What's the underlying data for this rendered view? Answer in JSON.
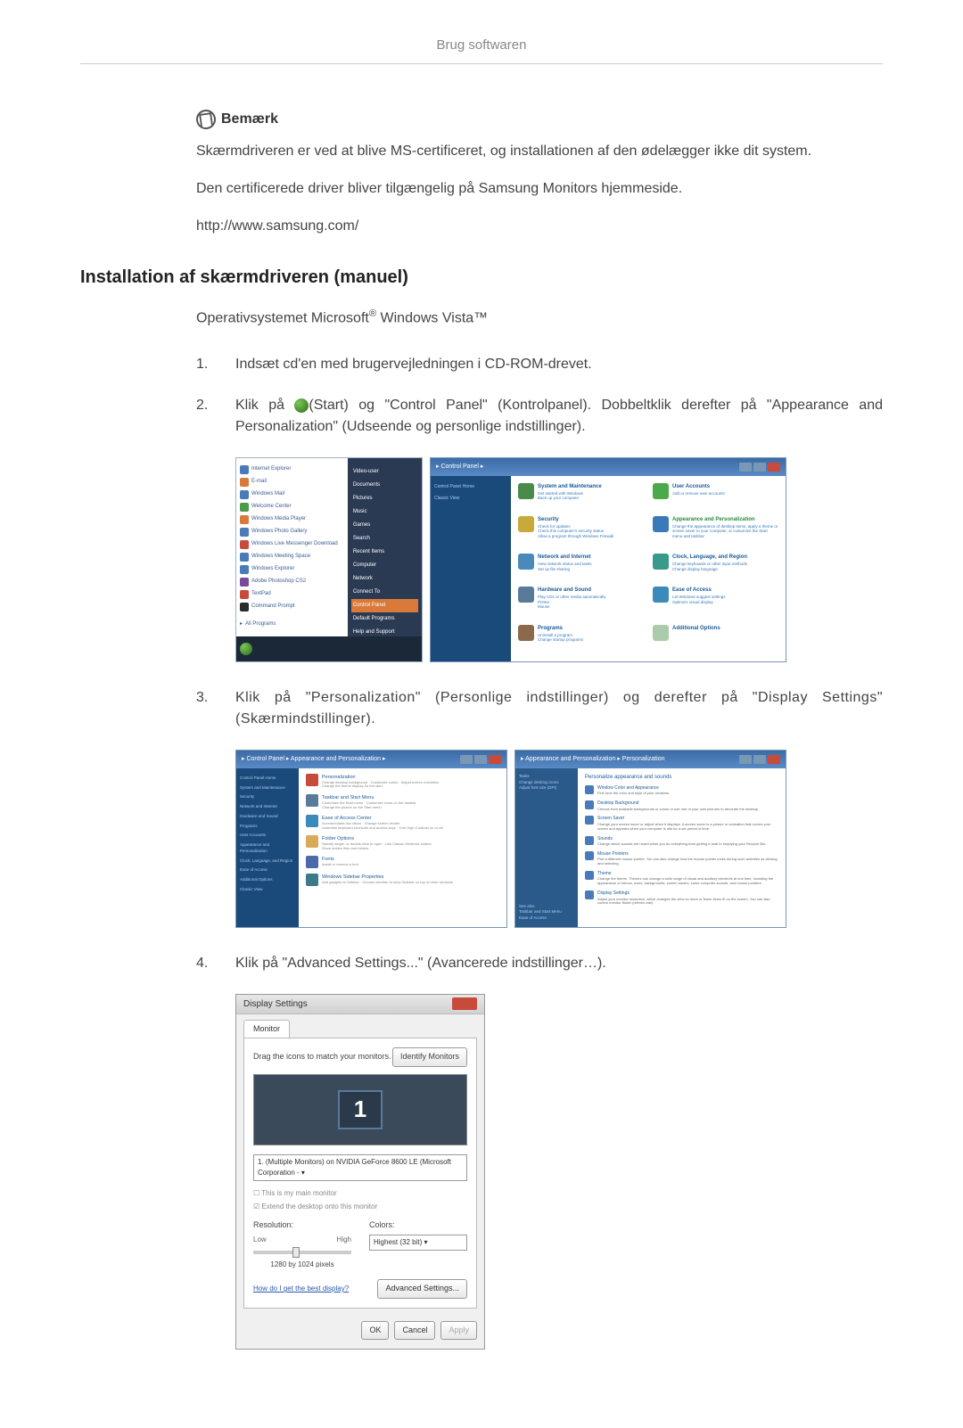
{
  "header": "Brug softwaren",
  "note": {
    "heading": "Bemærk",
    "para1": "Skærmdriveren er ved at blive MS-certificeret, og installationen af den ødelægger ikke dit system.",
    "para2": "Den certificerede driver bliver tilgængelig på Samsung Monitors hjemmeside.",
    "link": "http://www.samsung.com/"
  },
  "section": {
    "heading": "Installation af skærmdriveren (manuel)",
    "subtitle_pre": "Operativsystemet Microsoft",
    "subtitle_reg": "®",
    "subtitle_mid": " Windows Vista",
    "subtitle_tm": "™"
  },
  "steps": {
    "s1": {
      "num": "1.",
      "text": "Indsæt cd'en med brugervejledningen i CD-ROM-drevet."
    },
    "s2": {
      "num": "2.",
      "text_a": "Klik på ",
      "text_b": "(Start) og \"Control Panel\" (Kontrolpanel). Dobbeltklik derefter på \"Appearance and Personalization\" (Udseende og personlige indstillinger)."
    },
    "s3": {
      "num": "3.",
      "text": "Klik på \"Personalization\" (Personlige indstillinger) og derefter på \"Display Settings\" (Skærmindstillinger)."
    },
    "s4": {
      "num": "4.",
      "text": "Klik på \"Advanced Settings...\" (Avancerede indstillinger…)."
    }
  },
  "start_menu": {
    "items": [
      "Internet Explorer",
      "E-mail",
      "Windows Mail",
      "Welcome Center",
      "Windows Media Player",
      "Windows Photo Gallery",
      "Windows Live Messenger Download",
      "Windows Meeting Space",
      "Windows Explorer",
      "Adobe Photoshop CS2",
      "TextPad",
      "Command Prompt"
    ],
    "all_programs": "All Programs",
    "right": [
      "Video-user",
      "Documents",
      "Pictures",
      "Music",
      "Games",
      "Search",
      "Recent Items",
      "Computer",
      "Network",
      "Connect To",
      "Control Panel",
      "Default Programs",
      "Help and Support"
    ]
  },
  "control_panel": {
    "title": "Control Panel",
    "breadcrumb": "▸ Control Panel ▸",
    "sidebar": [
      "Control Panel Home",
      "Classic View"
    ],
    "cats": [
      {
        "title": "System and Maintenance",
        "sub": "Get started with Windows\nBack up your computer",
        "color": "#4a8a4a"
      },
      {
        "title": "User Accounts",
        "sub": "Add or remove user accounts",
        "color": "#4aaa4a"
      },
      {
        "title": "Security",
        "sub": "Check for updates\nCheck this computer's security status\nAllow a program through Windows Firewall",
        "color": "#c8aa3a"
      },
      {
        "title": "Appearance and Personalization",
        "sub": "Change the appearance of desktop items, apply a theme or screen saver to your computer, or customize the Start menu and taskbar",
        "color": "#3a7aba",
        "highlight": true
      },
      {
        "title": "Network and Internet",
        "sub": "View network status and tasks\nSet up file sharing",
        "color": "#4a8aba"
      },
      {
        "title": "Clock, Language, and Region",
        "sub": "Change keyboards or other input methods\nChange display language",
        "color": "#3a9a8a"
      },
      {
        "title": "Hardware and Sound",
        "sub": "Play CDs or other media automatically\nPrinter\nMouse",
        "color": "#5a7a9a"
      },
      {
        "title": "Ease of Access",
        "sub": "Let Windows suggest settings\nOptimize visual display",
        "color": "#3a8aba"
      },
      {
        "title": "Programs",
        "sub": "Uninstall a program\nChange startup programs",
        "color": "#8a6a4a"
      },
      {
        "title": "Additional Options",
        "sub": "",
        "color": "#aaccaa"
      }
    ]
  },
  "personalization1": {
    "breadcrumb": "▸ Control Panel ▸ Appearance and Personalization ▸",
    "sidebar": [
      "Control Panel Home",
      "System and Maintenance",
      "Security",
      "Network and Internet",
      "Hardware and Sound",
      "Programs",
      "User Accounts",
      "Appearance and Personalization",
      "Clock, Language, and Region",
      "Ease of Access",
      "Additional Options",
      "Classic View"
    ],
    "items": [
      {
        "title": "Personalization",
        "sub": "Change desktop background · Customize colors · Adjust screen resolution\nChange the theme display for the start",
        "color": "#c84a3a"
      },
      {
        "title": "Taskbar and Start Menu",
        "sub": "Customize the Start menu · Customize icons on the taskbar\nChange the picture on the Start menu",
        "color": "#5a7a9a"
      },
      {
        "title": "Ease of Access Center",
        "sub": "Accommodate low vision · Change screen reader\nUnderline keyboard shortcuts and access keys · Turn High Contrast on or off",
        "color": "#3a8aba"
      },
      {
        "title": "Folder Options",
        "sub": "Specify single- or double-click to open · Use Classic Windows folders\nShow hidden files and folders",
        "color": "#d9aa5a"
      },
      {
        "title": "Fonts",
        "sub": "Install or remove a font",
        "color": "#4a6aaa"
      },
      {
        "title": "Windows Sidebar Properties",
        "sub": "Add gadgets to Sidebar · Choose whether to keep Sidebar on top of other windows",
        "color": "#3a7a8a"
      }
    ]
  },
  "personalization2": {
    "breadcrumb": "▸ Appearance and Personalization ▸ Personalization",
    "heading": "Personalize appearance and sounds",
    "sidebar": [
      "Tasks",
      "Change desktop icons",
      "Adjust font size (DPI)"
    ],
    "items": [
      {
        "title": "Window Color and Appearance",
        "sub": "Fine tune the color and style of your windows."
      },
      {
        "title": "Desktop Background",
        "sub": "Choose from available backgrounds or colors or use one of your own pictures to decorate the desktop."
      },
      {
        "title": "Screen Saver",
        "sub": "Change your screen saver or adjust when it displays. A screen saver is a picture or animation that covers your screen and appears when your computer is idle for a set period of time."
      },
      {
        "title": "Sounds",
        "sub": "Change which sounds are heard when you do everything from getting e-mail to emptying your Recycle Bin."
      },
      {
        "title": "Mouse Pointers",
        "sub": "Pick a different mouse pointer. You can also change how the mouse pointer looks during such activities as clicking and selecting."
      },
      {
        "title": "Theme",
        "sub": "Change the theme. Themes can change a wide range of visual and auditory elements at one time, including the appearance of menus, icons, backgrounds, screen savers, some computer sounds, and mouse pointers."
      },
      {
        "title": "Display Settings",
        "sub": "Adjust your monitor resolution, which changes the view so more or fewer items fit on the screen. You can also control monitor flicker (refresh rate)."
      }
    ],
    "seealso": [
      "See also",
      "Taskbar and Start Menu",
      "Ease of Access"
    ]
  },
  "display_settings": {
    "title": "Display Settings",
    "tab": "Monitor",
    "drag_text": "Drag the icons to match your monitors.",
    "identify_btn": "Identify Monitors",
    "monitor_num": "1",
    "dropdown": "1. (Multiple Monitors) on NVIDIA GeForce 8600 LE (Microsoft Corporation - ▾",
    "check1": "This is my main monitor",
    "check2": "Extend the desktop onto this monitor",
    "resolution_label": "Resolution:",
    "res_low": "Low",
    "res_high": "High",
    "res_value": "1280 by 1024 pixels",
    "colors_label": "Colors:",
    "colors_value": "Highest (32 bit)   ▾",
    "help_link": "How do I get the best display?",
    "advanced_btn": "Advanced Settings...",
    "ok_btn": "OK",
    "cancel_btn": "Cancel",
    "apply_btn": "Apply"
  }
}
